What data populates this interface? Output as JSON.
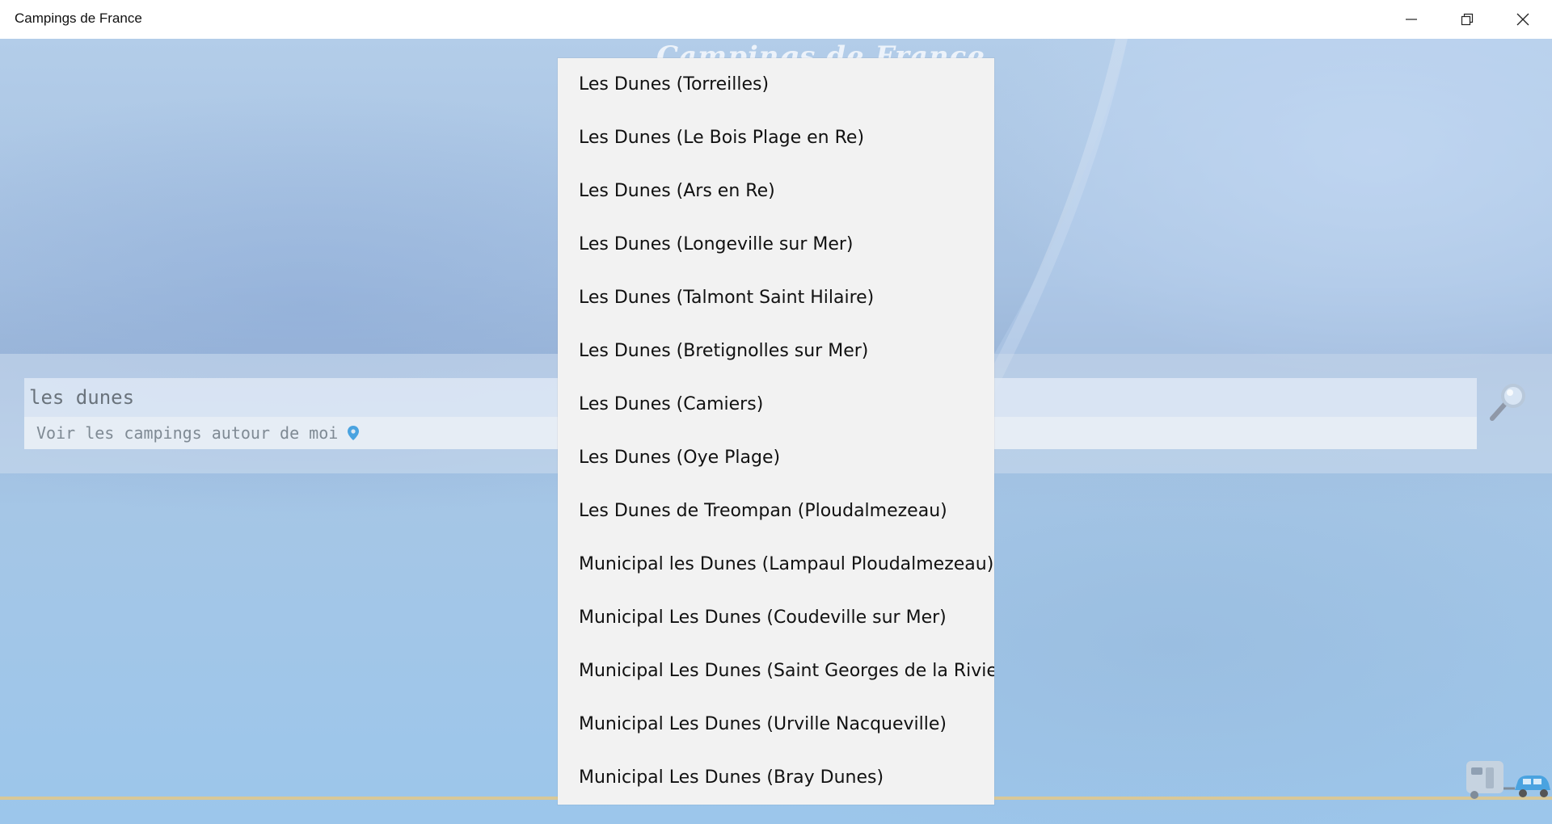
{
  "window": {
    "title": "Campings de France",
    "controls": [
      "minimize-icon",
      "restore-icon",
      "close-icon"
    ]
  },
  "background": {
    "logo_text": "Campings de France"
  },
  "search": {
    "query": "les dunes",
    "nearby_label": "Voir les campings autour de moi",
    "nearby_icon": "map-pin-icon",
    "search_icon": "magnifier-icon"
  },
  "suggestions": [
    "Les Dunes (Torreilles)",
    "Les Dunes (Le Bois Plage en Re)",
    "Les Dunes (Ars en Re)",
    "Les Dunes (Longeville sur Mer)",
    "Les Dunes (Talmont Saint Hilaire)",
    "Les Dunes (Bretignolles sur Mer)",
    "Les Dunes (Camiers)",
    "Les Dunes (Oye Plage)",
    "Les Dunes de Treompan (Ploudalmezeau)",
    "Municipal les Dunes (Lampaul Ploudalmezeau)",
    "Municipal Les Dunes (Coudeville sur Mer)",
    "Municipal Les Dunes (Saint Georges de la Riviere)",
    "Municipal Les Dunes (Urville Nacqueville)",
    "Municipal Les Dunes (Bray Dunes)"
  ],
  "colors": {
    "accent_pin": "#4aa3e0",
    "dropdown_bg": "#f2f2f2"
  }
}
